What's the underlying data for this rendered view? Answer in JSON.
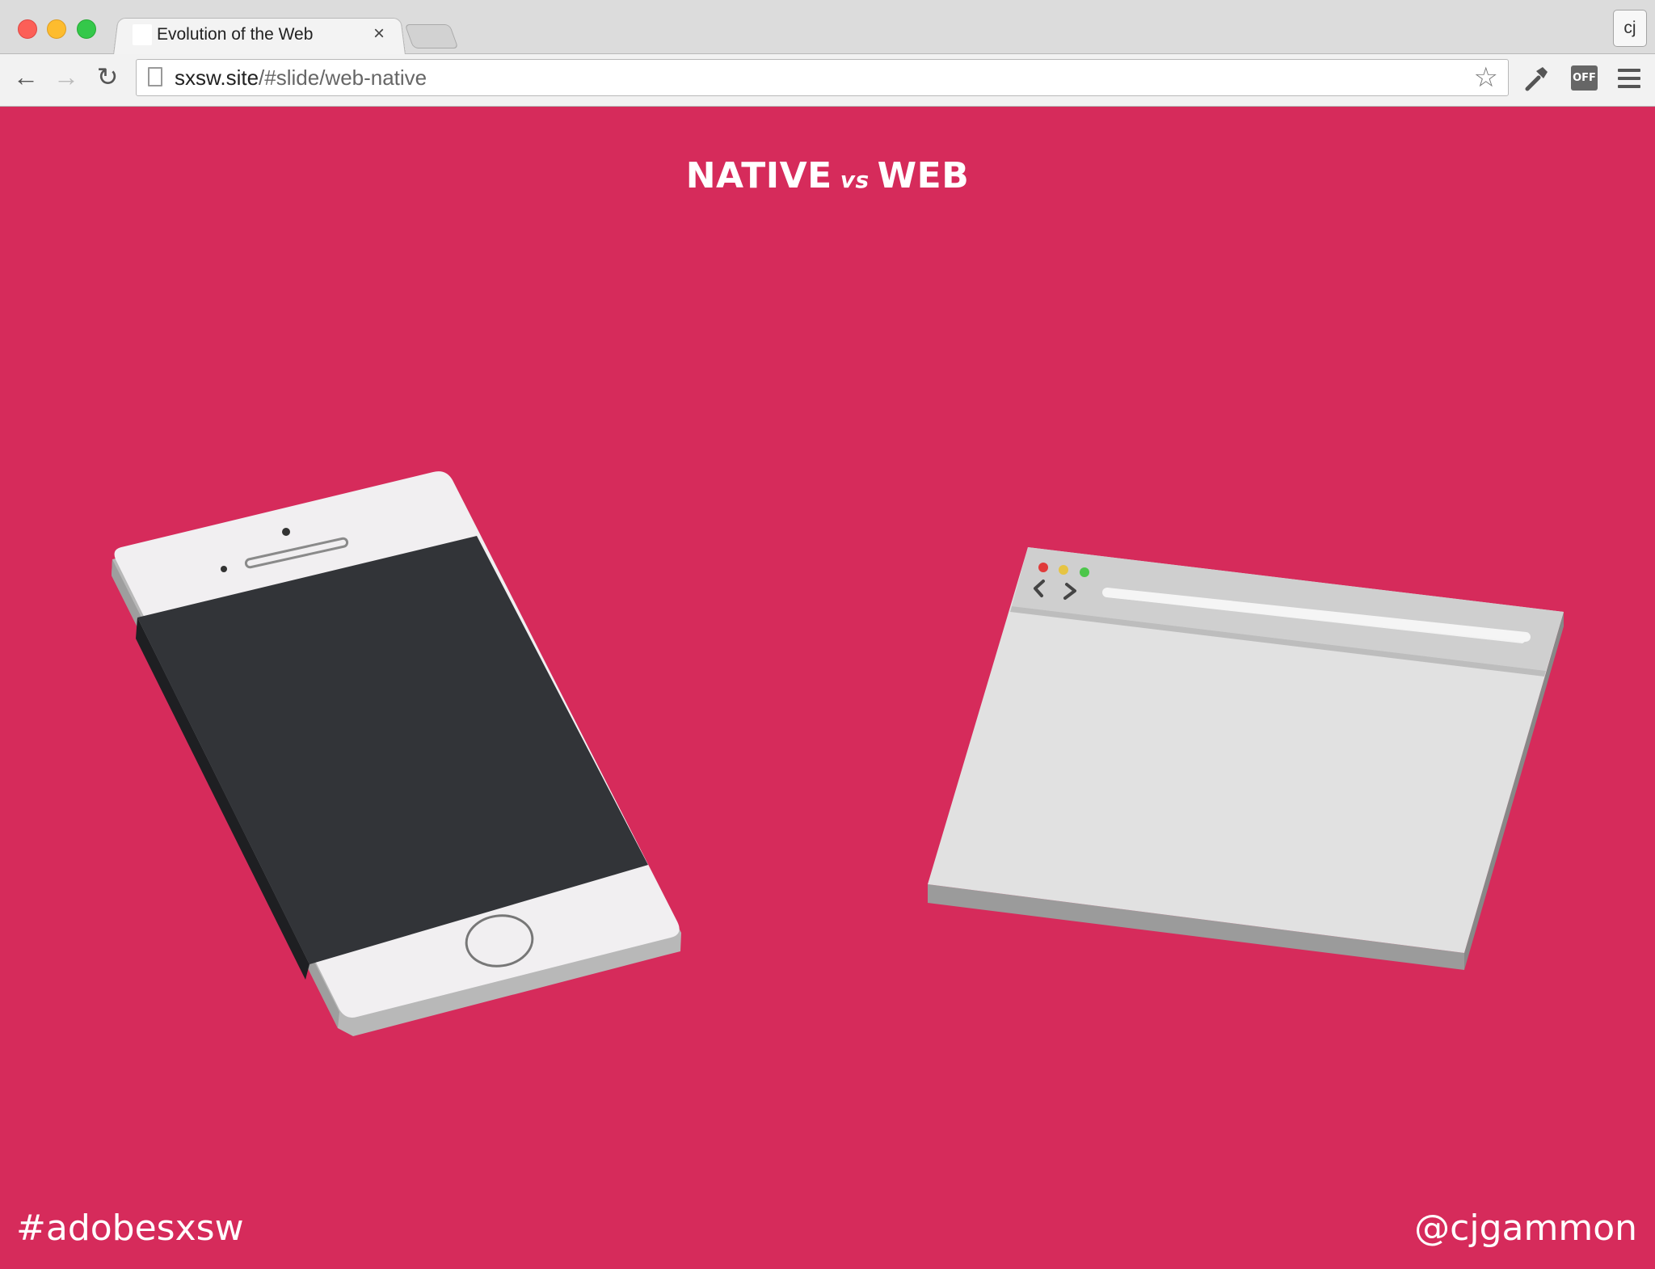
{
  "window": {
    "tab_title": "Evolution of the Web",
    "tab_close": "×",
    "profile_initials": "cj"
  },
  "toolbar": {
    "back_icon": "←",
    "forward_icon": "→",
    "reload_icon": "↻",
    "url_host": "sxsw.site",
    "url_path": "/#slide/web-native",
    "bookmark_icon": "☆",
    "extension_off_label": "OFF"
  },
  "slide": {
    "title_left": "NATIVE",
    "title_vs": "vs",
    "title_right": "WEB",
    "hashtag": "#adobesxsw",
    "handle": "@cjgammon",
    "background_color": "#d62b5b"
  }
}
